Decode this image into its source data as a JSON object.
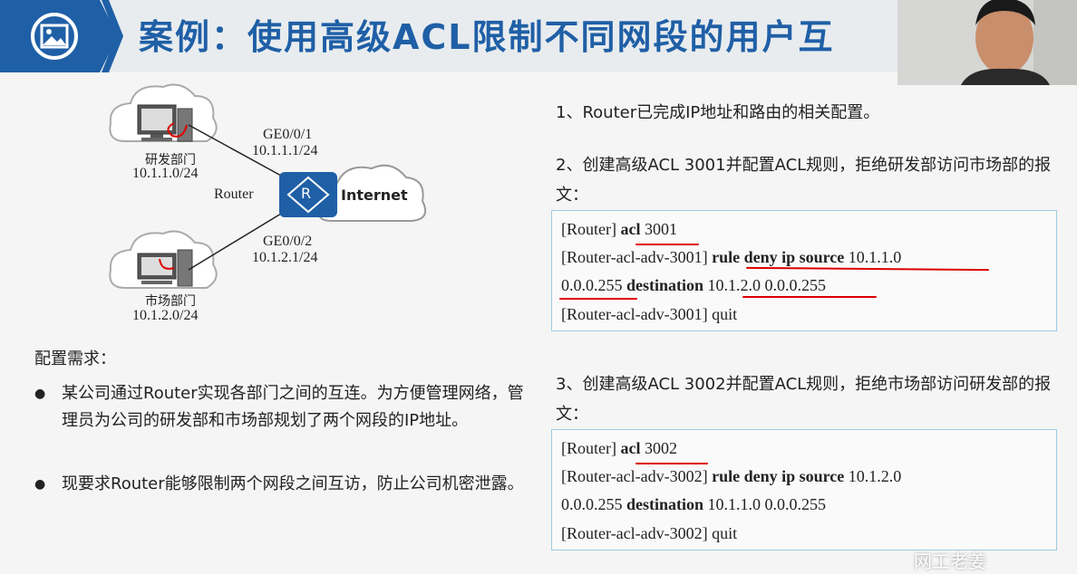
{
  "header": {
    "title": "案例：使用高级ACL限制不同网段的用户互",
    "watermark": "网工老姜"
  },
  "diagram": {
    "research_dept": {
      "label": "研发部门",
      "subnet": "10.1.1.0/24"
    },
    "market_dept": {
      "label": "市场部门",
      "subnet": "10.1.2.0/24"
    },
    "link1": {
      "port": "GE0/0/1",
      "ip": "10.1.1.1/24"
    },
    "link2": {
      "port": "GE0/0/2",
      "ip": "10.1.2.1/24"
    },
    "router_label": "Router",
    "router_icon_letter": "R",
    "internet_label": "Internet"
  },
  "requirements": {
    "title": "配置需求：",
    "bullets": [
      "某公司通过Router实现各部门之间的互连。为方便管理网络，管理员为公司的研发部和市场部规划了两个网段的IP地址。",
      "现要求Router能够限制两个网段之间互访，防止公司机密泄露。"
    ]
  },
  "steps": {
    "step1": "1、Router已完成IP地址和路由的相关配置。",
    "step2": "2、创建高级ACL 3001并配置ACL规则，拒绝研发部访问市场部的报文：",
    "step3": "3、创建高级ACL 3002并配置ACL规则，拒绝市场部访问研发部的报文："
  },
  "code1": {
    "l1_prompt": "[Router] ",
    "l1_cmd": "acl",
    "l1_arg": " 3001",
    "l2_prompt": "[Router-acl-adv-3001] ",
    "l2_cmd": "rule deny ip source",
    "l2_arg": " 10.1.1.0",
    "l3_arg1": "0.0.0.255 ",
    "l3_cmd": "destination",
    "l3_arg2": " 10.1.2.0 0.0.0.255",
    "l4": "[Router-acl-adv-3001] quit"
  },
  "code2": {
    "l1_prompt": "[Router] ",
    "l1_cmd": "acl",
    "l1_arg": " 3002",
    "l2_prompt": "[Router-acl-adv-3002] ",
    "l2_cmd": "rule deny ip source",
    "l2_arg": " 10.1.2.0",
    "l3_arg1": "0.0.0.255 ",
    "l3_cmd": "destination",
    "l3_arg2": " 10.1.1.0 0.0.0.255",
    "l4": "[Router-acl-adv-3002] quit"
  },
  "colors": {
    "accent": "#1f5fa6",
    "annotation": "#dd0000",
    "code_border": "#9fcbe0"
  }
}
